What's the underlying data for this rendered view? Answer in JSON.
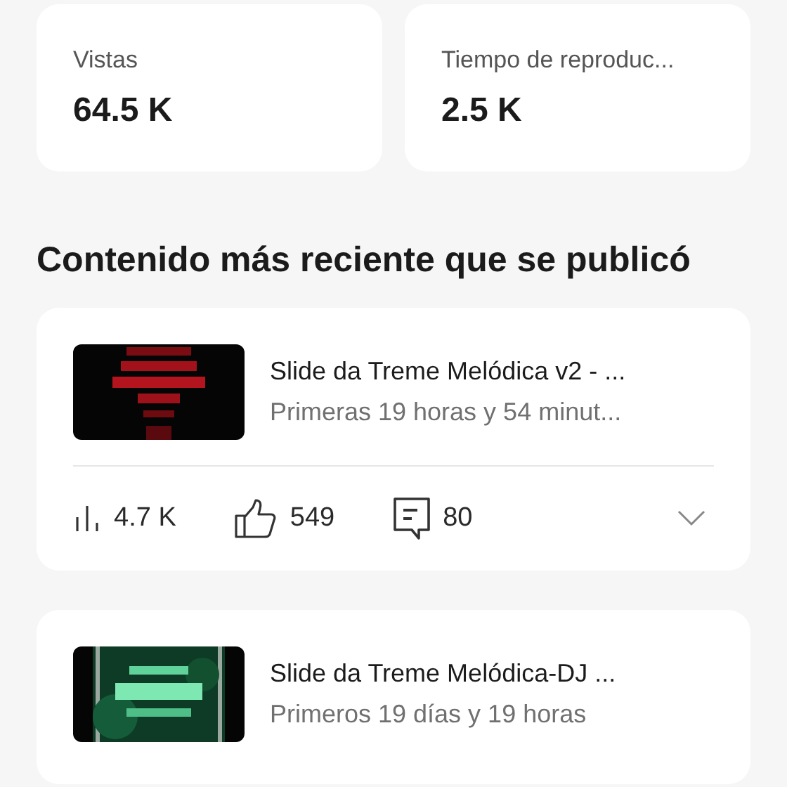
{
  "metrics": [
    {
      "label": "Vistas",
      "value": "64.5 K"
    },
    {
      "label": "Tiempo de reproduc...",
      "value": "2.5 K"
    }
  ],
  "section_title": "Contenido más reciente que se publicó",
  "videos": [
    {
      "title": "Slide da Treme Melódica v2 - ...",
      "subtitle": "Primeras 19 horas y 54 minut...",
      "stats": {
        "views": "4.7 K",
        "likes": "549",
        "comments": "80"
      },
      "expanded": false
    },
    {
      "title": "Slide da Treme Melódica-DJ ...",
      "subtitle": "Primeros 19 días y 19 horas"
    }
  ]
}
